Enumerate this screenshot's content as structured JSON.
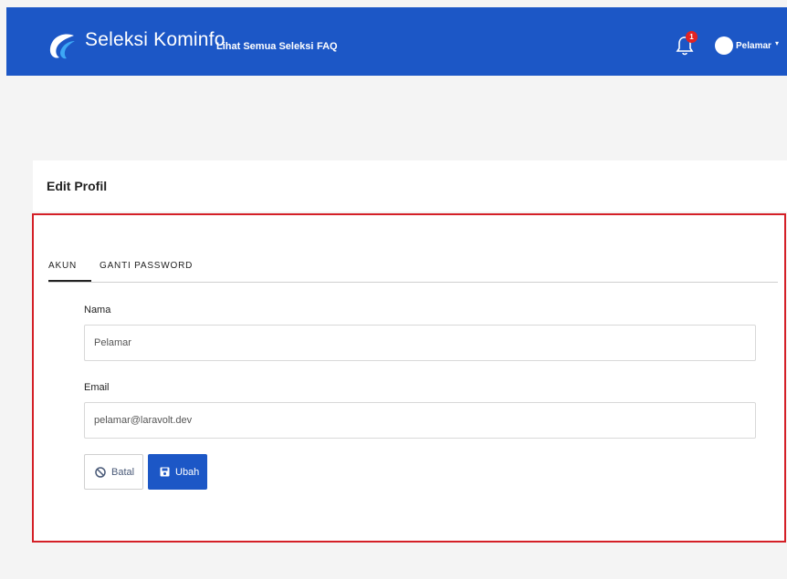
{
  "header": {
    "brand": "Seleksi Kominfo",
    "nav": [
      {
        "label": "Lihat Semua Seleksi"
      },
      {
        "label": "FAQ"
      }
    ],
    "notification_count": "1",
    "user_name": "Pelamar",
    "user_caret": "▾",
    "colors": {
      "bar": "#1c57c6",
      "badge": "#e02424"
    }
  },
  "page": {
    "title": "Edit Profil"
  },
  "tabs": [
    {
      "label": "AKUN",
      "active": true
    },
    {
      "label": "GANTI PASSWORD",
      "active": false
    }
  ],
  "form": {
    "name_label": "Nama",
    "name_value": "Pelamar",
    "email_label": "Email",
    "email_value": "pelamar@laravolt.dev",
    "cancel_label": "Batal",
    "save_label": "Ubah",
    "cancel_icon": "ban-icon",
    "save_icon": "floppy-disk-icon"
  },
  "highlight": {
    "color": "#d42027"
  }
}
